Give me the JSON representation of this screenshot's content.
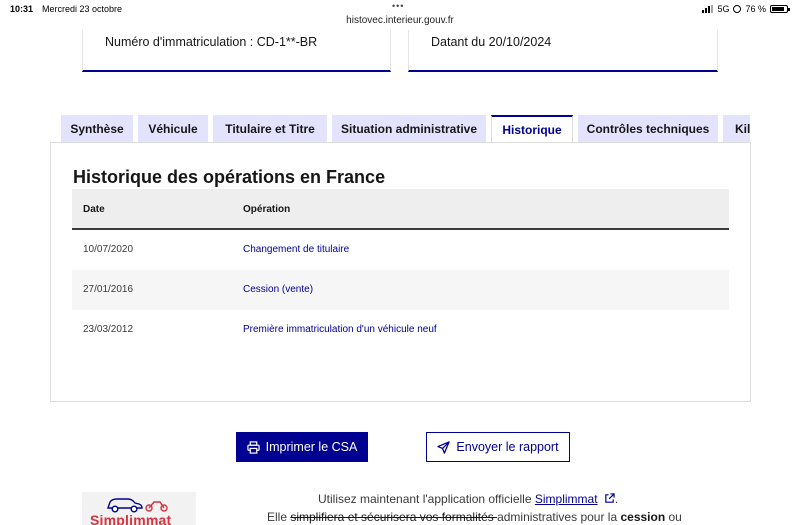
{
  "status_bar": {
    "time": "10:31",
    "date": "Mercredi 23 octobre",
    "url": "histovec.interieur.gouv.fr",
    "network": "5G",
    "battery": "76 %"
  },
  "cards": {
    "registration": "Numéro d'immatriculation : CD-1**-BR",
    "dated": "Datant du 20/10/2024"
  },
  "tabs": [
    {
      "label": "Synthèse"
    },
    {
      "label": "Véhicule"
    },
    {
      "label": "Titulaire et Titre"
    },
    {
      "label": "Situation administrative"
    },
    {
      "label": "Historique"
    },
    {
      "label": "Contrôles techniques"
    },
    {
      "label": "Kilométrage"
    }
  ],
  "active_tab": "Historique",
  "history": {
    "title": "Historique des opérations en France",
    "columns": {
      "date": "Date",
      "operation": "Opération"
    },
    "rows": [
      {
        "date": "10/07/2020",
        "operation": "Changement de titulaire"
      },
      {
        "date": "27/01/2016",
        "operation": "Cession (vente)"
      },
      {
        "date": "23/03/2012",
        "operation": "Première immatriculation d'un véhicule neuf"
      }
    ]
  },
  "actions": {
    "print_label": "Imprimer le CSA",
    "send_label": "Envoyer le rapport"
  },
  "promo": {
    "logo_text": "Simplimmat",
    "line1_prefix": "Utilisez maintenant l'application officielle ",
    "line1_link": "Simplimmat",
    "line1_suffix": ".",
    "line2_prefix": "Elle ",
    "line2_struck": "simplifiera et sécurisera vos formalités ",
    "line2_mid": "administratives pour la ",
    "line2_bold": "cession",
    "line2_suffix": " ou"
  },
  "colors": {
    "primary": "#000091",
    "tab_bg": "#e3e3fd",
    "row_alt": "#f6f6f6",
    "header_bg": "#eeeeee"
  }
}
